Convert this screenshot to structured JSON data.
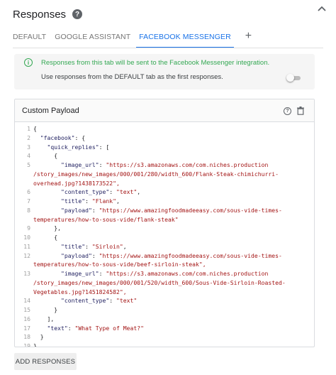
{
  "header": {
    "title": "Responses"
  },
  "tabs": [
    {
      "label": "DEFAULT",
      "active": false
    },
    {
      "label": "GOOGLE ASSISTANT",
      "active": false
    },
    {
      "label": "FACEBOOK MESSENGER",
      "active": true
    }
  ],
  "tabs_add_label": "+",
  "info": {
    "message": "Responses from this tab will be sent to the Facebook Messenger integration.",
    "default_toggle_label": "Use responses from the DEFAULT tab as the first responses.",
    "default_toggle_on": false
  },
  "payload": {
    "title": "Custom Payload",
    "lines": [
      {
        "n": "1",
        "text": "{"
      },
      {
        "n": "2",
        "text": "  \"facebook\": {"
      },
      {
        "n": "3",
        "text": "    \"quick_replies\": ["
      },
      {
        "n": "4",
        "text": "      {"
      },
      {
        "n": "5",
        "text": "        \"image_url\": \"https://s3.amazonaws.com/com.niches.production"
      },
      {
        "n": "",
        "text": "/story_images/new_images/000/001/280/width_600/Flank-Steak-chimichurri-"
      },
      {
        "n": "",
        "text": "overhead.jpg?1438173522\","
      },
      {
        "n": "6",
        "text": "        \"content_type\": \"text\","
      },
      {
        "n": "7",
        "text": "        \"title\": \"Flank\","
      },
      {
        "n": "8",
        "text": "        \"payload\": \"https://www.amazingfoodmadeeasy.com/sous-vide-times-"
      },
      {
        "n": "",
        "text": "temperatures/how-to-sous-vide/flank-steak\""
      },
      {
        "n": "9",
        "text": "      },"
      },
      {
        "n": "10",
        "text": "      {"
      },
      {
        "n": "11",
        "text": "        \"title\": \"Sirloin\","
      },
      {
        "n": "12",
        "text": "        \"payload\": \"https://www.amazingfoodmadeeasy.com/sous-vide-times-"
      },
      {
        "n": "",
        "text": "temperatures/how-to-sous-vide/beef-sirloin-steak\","
      },
      {
        "n": "13",
        "text": "        \"image_url\": \"https://s3.amazonaws.com/com.niches.production"
      },
      {
        "n": "",
        "text": "/story_images/new_images/000/001/520/width_600/Sous-Vide-Sirloin-Roasted-"
      },
      {
        "n": "",
        "text": "Vegetables.jpg?1451824582\","
      },
      {
        "n": "14",
        "text": "        \"content_type\": \"text\""
      },
      {
        "n": "15",
        "text": "      }"
      },
      {
        "n": "16",
        "text": "    ],"
      },
      {
        "n": "17",
        "text": "    \"text\": \"What Type of Meat?\""
      },
      {
        "n": "18",
        "text": "  }"
      },
      {
        "n": "19",
        "text": "}"
      }
    ]
  },
  "add_button_label": "ADD RESPONSES",
  "colors": {
    "accent": "#1a73e8",
    "success": "#34a853",
    "code_string": "#a31515"
  },
  "icons": {
    "help": "help-icon",
    "collapse": "chevron-up-icon",
    "info": "info-icon",
    "payload_help": "help-outline-icon",
    "delete": "trash-icon"
  }
}
